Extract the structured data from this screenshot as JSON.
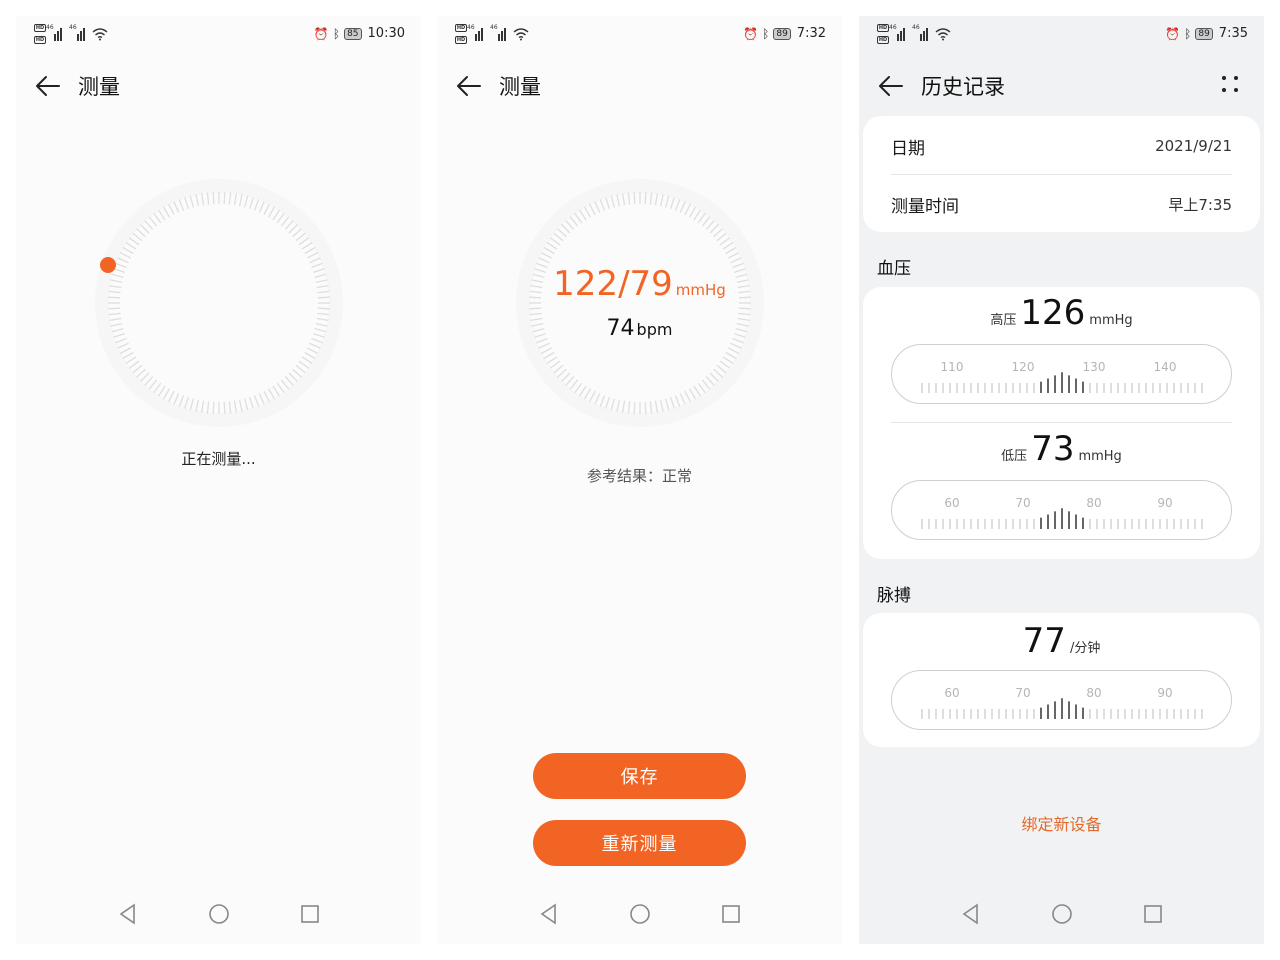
{
  "screens": [
    {
      "status": {
        "battery": "85",
        "time": "10:30"
      },
      "header": {
        "title": "测量"
      },
      "caption": "正在测量..."
    },
    {
      "status": {
        "battery": "89",
        "time": "7:32"
      },
      "header": {
        "title": "测量"
      },
      "reading": {
        "bp": "122/79",
        "bp_unit": "mmHg",
        "pulse": "74",
        "pulse_unit": "bpm"
      },
      "caption": "参考结果：正常",
      "buttons": {
        "save": "保存",
        "remeasure": "重新测量"
      }
    },
    {
      "status": {
        "battery": "89",
        "time": "7:35"
      },
      "header": {
        "title": "历史记录"
      },
      "info": {
        "date_label": "日期",
        "date_value": "2021/9/21",
        "time_label": "测量时间",
        "time_value": "早上7:35"
      },
      "bp_section": "血压",
      "systolic": {
        "label": "高压",
        "value": "126",
        "unit": "mmHg",
        "ticks": [
          "110",
          "120",
          "130",
          "140"
        ]
      },
      "diastolic": {
        "label": "低压",
        "value": "73",
        "unit": "mmHg",
        "ticks": [
          "60",
          "70",
          "80",
          "90"
        ]
      },
      "pulse_section": "脉搏",
      "pulse": {
        "value": "77",
        "unit": "/分钟",
        "ticks": [
          "60",
          "70",
          "80",
          "90"
        ]
      },
      "bind_device": "绑定新设备"
    }
  ],
  "colors": {
    "accent": "#f26424",
    "link": "#e36a2c"
  },
  "icons": {
    "back": "arrow-left-icon",
    "more": "four-dots-icon",
    "nav": [
      "back-triangle-icon",
      "home-circle-icon",
      "recents-square-icon"
    ]
  }
}
